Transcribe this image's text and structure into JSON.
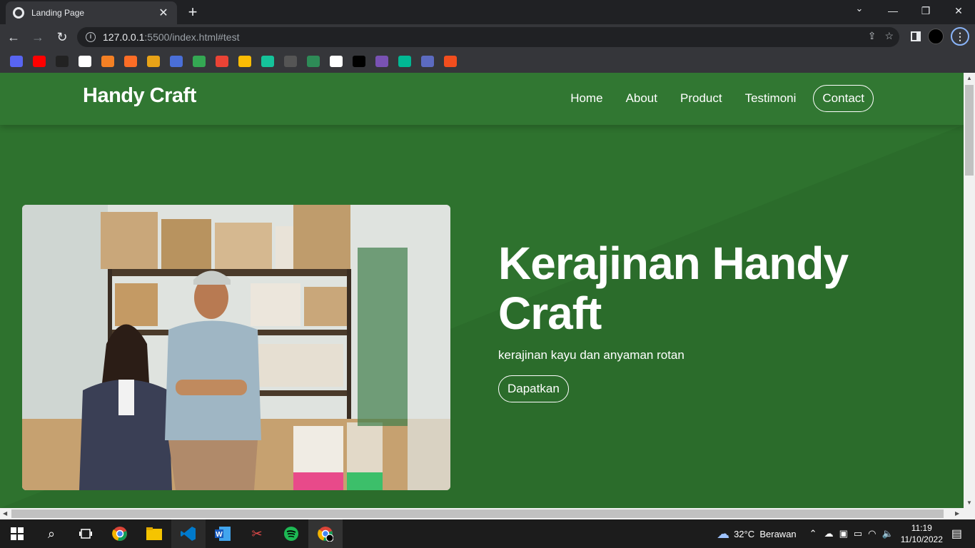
{
  "browser": {
    "tab_title": "Landing Page",
    "url_host": "127.0.0.1",
    "url_path": ":5500/index.html#test",
    "new_tab_label": "+",
    "close_label": "✕"
  },
  "bookmarks": [
    {
      "name": "discord",
      "color": "#5865f2"
    },
    {
      "name": "youtube",
      "color": "#ff0000"
    },
    {
      "name": "laptop",
      "color": "#222222"
    },
    {
      "name": "github",
      "color": "#ffffff"
    },
    {
      "name": "stackoverflow",
      "color": "#f48024"
    },
    {
      "name": "gitlab",
      "color": "#fc6d26"
    },
    {
      "name": "infinity",
      "color": "#e8a317"
    },
    {
      "name": "app-blue",
      "color": "#4a6fd8"
    },
    {
      "name": "maps",
      "color": "#34a853"
    },
    {
      "name": "gmail",
      "color": "#ea4335"
    },
    {
      "name": "drive",
      "color": "#fbbc04"
    },
    {
      "name": "grammarly",
      "color": "#15c39a"
    },
    {
      "name": "box",
      "color": "#555555"
    },
    {
      "name": "m-app",
      "color": "#2e8b57"
    },
    {
      "name": "circle-app",
      "color": "#ffffff"
    },
    {
      "name": "medium",
      "color": "#000000"
    },
    {
      "name": "bootstrap",
      "color": "#7952b3"
    },
    {
      "name": "diamond",
      "color": "#00b894"
    },
    {
      "name": "vs-blue",
      "color": "#5c6bc0"
    },
    {
      "name": "figma",
      "color": "#f24e1e"
    }
  ],
  "site": {
    "brand": "Handy Craft",
    "nav": [
      "Home",
      "About",
      "Product",
      "Testimoni",
      "Contact"
    ],
    "hero_title": "Kerajinan Handy Craft",
    "hero_subtitle": "kerajinan kayu dan anyaman rotan",
    "hero_button": "Dapatkan",
    "bg_color": "#2e722e",
    "nav_color": "#317732"
  },
  "taskbar": {
    "weather": "32°C  Berawan",
    "time": "11:19",
    "date": "11/10/2022"
  }
}
